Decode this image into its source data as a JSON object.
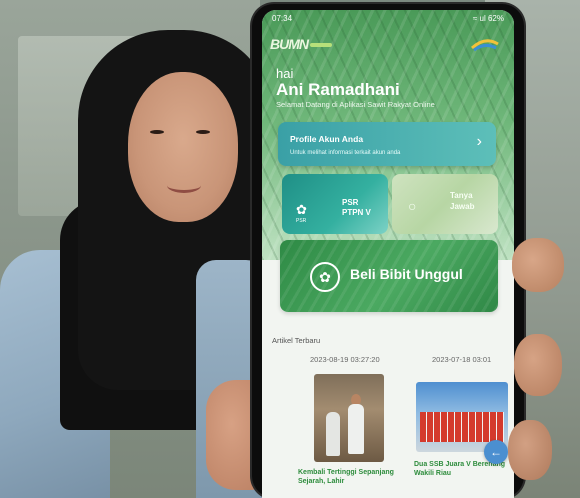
{
  "status_bar": {
    "time": "07:34",
    "indicators": "≈ ul 62%"
  },
  "header": {
    "logo_text": "BUMN",
    "greeting": "hai",
    "user_name": "Ani Ramadhani",
    "welcome": "Selamat Datang di Aplikasi Sawit Rakyat Online"
  },
  "profile_card": {
    "title": "Profile Akun Anda",
    "subtitle": "Untuk melihat informasi terkait akun anda",
    "chevron": "›"
  },
  "tiles": {
    "psr": {
      "label": "PSR\nPTPN V",
      "icon_caption": "PSR"
    },
    "tanya": {
      "label": "Tanya\nJawab"
    },
    "bibit": {
      "label": "Beli Bibit Unggul"
    }
  },
  "articles": {
    "section_title": "Artikel Terbaru",
    "items": [
      {
        "date": "2023-08-19 03:27:20",
        "caption": "Kembali Tertinggi Sepanjang Sejarah, Lahir"
      },
      {
        "date": "2023-07-18 03:01",
        "caption": "Dua SSB Juara V Berenang Wakili Riau"
      }
    ]
  },
  "fab": {
    "icon": "arrow-left-icon",
    "glyph": "←"
  },
  "colors": {
    "brand_green": "#2e8a45",
    "card_teal": "#3aa0a6",
    "fab_blue": "#4b8fd0"
  }
}
